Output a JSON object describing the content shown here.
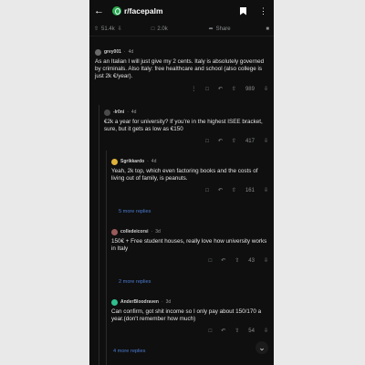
{
  "header": {
    "back_icon": "arrow-left-icon",
    "subreddit": "r/facepalm"
  },
  "stats": {
    "upvotes": "51.4k",
    "comments": "2.0k",
    "share": "Share"
  },
  "comments": [
    {
      "user": "grey001",
      "age": "4d",
      "body": "As an Italian I will just give my 2 cents. Italy is absolutely governed by criminals. Also Italy: free healthcare and school (also college is just 2k €/year).",
      "score": "989"
    },
    {
      "user": "-Ir0ni",
      "age": "4d",
      "body": "€2k a year for university? If you're in the highest ISEE bracket, sure, but it gets as low as €150",
      "score": "417"
    },
    {
      "user": "Sgrikkardo",
      "age": "4d",
      "body": "Yeah, 2k top, which even factoring books and the costs of living out of family, is peanuts.",
      "score": "161",
      "more": "5 more replies"
    },
    {
      "user": "colledeicorsi",
      "age": "3d",
      "body": "150€ + Free student houses, really love how university works in Italy",
      "score": "43",
      "more": "2 more replies"
    },
    {
      "user": "AnderBloodraven",
      "age": "3d",
      "body": "Can confirm, got shit income so I only pay about 150/170 a year.(don't remember how much)",
      "score": "54",
      "more": "4 more replies"
    }
  ]
}
